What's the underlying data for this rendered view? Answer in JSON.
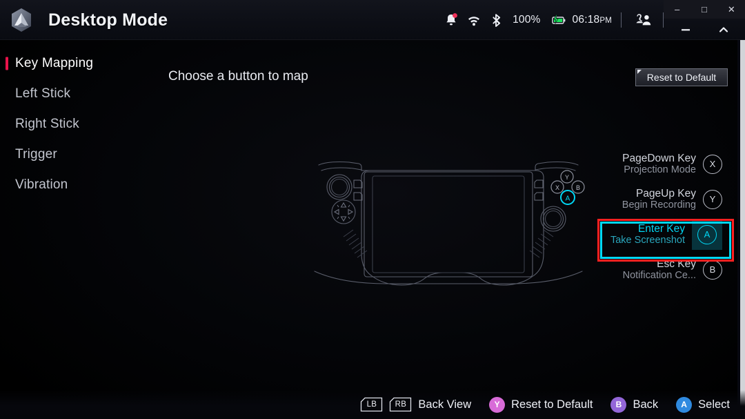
{
  "window": {
    "app_title": "Desktop Mode",
    "logo_icon": "hexagon-logo-icon",
    "controls": {
      "minimize": "–",
      "maximize": "□",
      "close": "✕",
      "minimize2": "–",
      "collapse2": "⌃"
    }
  },
  "statusbar": {
    "notification_icon": "bell-icon",
    "wifi_icon": "wifi-icon",
    "bluetooth_icon": "bluetooth-icon",
    "battery_percent": "100%",
    "battery_icon": "battery-charging-icon",
    "time": "06:18",
    "ampm": "PM",
    "user_icon": "user-account-icon"
  },
  "sidebar": {
    "items": [
      {
        "label": "Key Mapping",
        "active": true
      },
      {
        "label": "Left Stick",
        "active": false
      },
      {
        "label": "Right Stick",
        "active": false
      },
      {
        "label": "Trigger",
        "active": false
      },
      {
        "label": "Vibration",
        "active": false
      }
    ],
    "accent_color": "#e8134a"
  },
  "main": {
    "hint": "Choose a button to map",
    "reset_button": "Reset to Default",
    "controller_icon": "handheld-gamepad-outline-icon",
    "highlighted_button": "A"
  },
  "keylist": {
    "rows": [
      {
        "key": "PageDown Key",
        "action": "Projection Mode",
        "button": "X",
        "selected": false
      },
      {
        "key": "PageUp Key",
        "action": "Begin Recording",
        "button": "Y",
        "selected": false
      },
      {
        "key": "Enter Key",
        "action": "Take Screenshot",
        "button": "A",
        "selected": true
      },
      {
        "key": "Esc Key",
        "action": "Notification Ce...",
        "button": "B",
        "selected": false
      }
    ],
    "selected_outline_color": "#ff2020",
    "selected_inner_color": "#00d8f5"
  },
  "bottombar": {
    "items": [
      {
        "type": "shoulder",
        "badges": [
          "LB",
          "RB"
        ],
        "label": "Back View"
      },
      {
        "type": "pad",
        "glyph": "Y",
        "label": "Reset to Default",
        "color": "#d86bd8"
      },
      {
        "type": "pad",
        "glyph": "B",
        "label": "Back",
        "color": "#9366d8"
      },
      {
        "type": "pad",
        "glyph": "A",
        "label": "Select",
        "color": "#2f8ae0"
      }
    ]
  }
}
